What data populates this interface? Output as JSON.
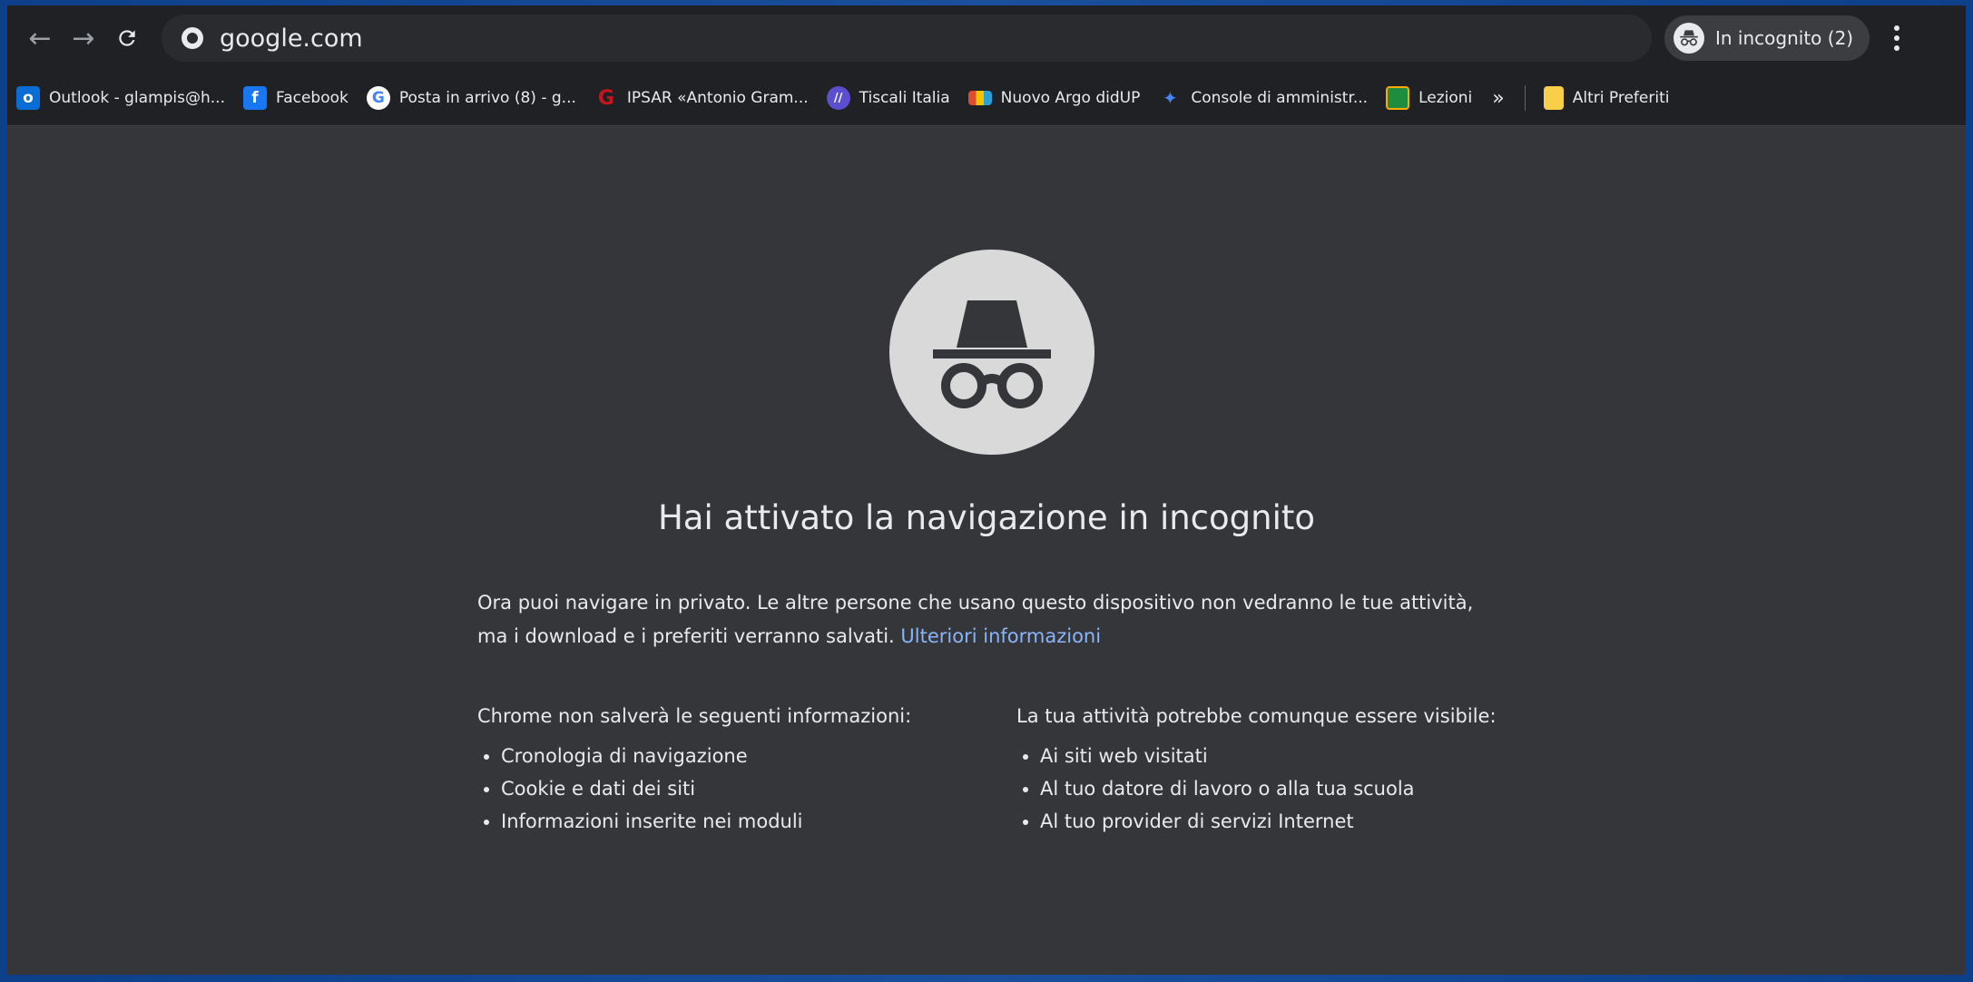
{
  "toolbar": {
    "back_icon": "arrow-left",
    "forward_icon": "arrow-right",
    "reload_icon": "reload",
    "url": "google.com",
    "incognito_label": "In incognito (2)"
  },
  "bookmarks": [
    {
      "label": "Outlook - glampis@h...",
      "icon": "outlook-icon",
      "color": "#0a6cd5"
    },
    {
      "label": "Facebook",
      "icon": "facebook-icon",
      "color": "#1877f2"
    },
    {
      "label": "Posta in arrivo (8) - g...",
      "icon": "google-icon",
      "color": "#ffffff"
    },
    {
      "label": "IPSAR «Antonio Gram...",
      "icon": "ipsar-icon",
      "color": "#c4161c"
    },
    {
      "label": "Tiscali Italia",
      "icon": "tiscali-icon",
      "color": "#5b4fcf"
    },
    {
      "label": "Nuovo Argo didUP",
      "icon": "argo-icon",
      "color": "#e04b2b"
    },
    {
      "label": "Console di amministr...",
      "icon": "console-icon",
      "color": "#4285f4"
    },
    {
      "label": "Lezioni",
      "icon": "classroom-icon",
      "color": "#1e8e3e"
    }
  ],
  "bookmarks_more": "»",
  "other_bookmarks": "Altri Preferiti",
  "page": {
    "headline": "Hai attivato la navigazione in incognito",
    "intro": "Ora puoi navigare in privato. Le altre persone che usano questo dispositivo non vedranno le tue attività, ma i download e i preferiti verranno salvati.",
    "learn_more": "Ulteriori informazioni",
    "left_heading": "Chrome non salverà le seguenti informazioni:",
    "left_items": [
      "Cronologia di navigazione",
      "Cookie e dati dei siti",
      "Informazioni inserite nei moduli"
    ],
    "right_heading": "La tua attività potrebbe comunque essere visibile:",
    "right_items": [
      "Ai siti web visitati",
      "Al tuo datore di lavoro o alla tua scuola",
      "Al tuo provider di servizi Internet"
    ]
  },
  "colors": {
    "background": "#35363a",
    "toolbar": "#202124",
    "link": "#8ab4f8",
    "hero_circle": "#d9d9d9"
  }
}
